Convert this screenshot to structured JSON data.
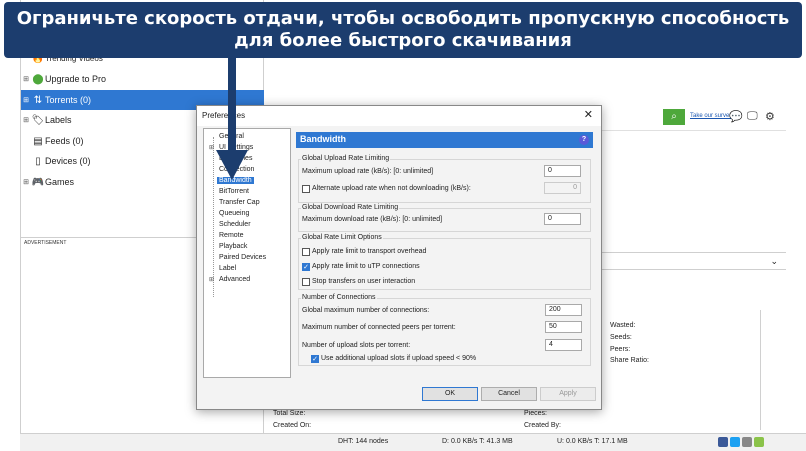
{
  "banner": {
    "text": "Ограничьте скорость отдачи, чтобы освободить пропускную способность для более быстрого скачивания"
  },
  "sidebar": {
    "items": [
      {
        "label": "Trending Videos",
        "icon": "flame-icon"
      },
      {
        "label": "Upgrade to Pro",
        "icon": "upgrade-icon"
      },
      {
        "label": "Torrents (0)",
        "icon": "torrents-icon"
      },
      {
        "label": "Labels",
        "icon": "tag-icon"
      },
      {
        "label": "Feeds (0)",
        "icon": "feed-icon"
      },
      {
        "label": "Devices (0)",
        "icon": "device-icon"
      },
      {
        "label": "Games",
        "icon": "gamepad-icon"
      }
    ],
    "ad_label": "ADVERTISEMENT"
  },
  "toolbar": {
    "survey_link": "Take our survey"
  },
  "details": {
    "labels": {
      "wasted": "Wasted:",
      "seeds": "Seeds:",
      "peers": "Peers:",
      "share_ratio": "Share Ratio:",
      "total_size": "Total Size:",
      "created_on": "Created On:",
      "pieces": "Pieces:",
      "created_by": "Created By:"
    }
  },
  "statusbar": {
    "dht": "DHT: 144 nodes",
    "down": "D: 0.0 KB/s T: 41.3 MB",
    "up": "U: 0.0 KB/s T: 17.1 MB"
  },
  "dialog": {
    "title": "Preferences",
    "tree": [
      "General",
      "UI Settings",
      "Directories",
      "Connection",
      "Bandwidth",
      "BitTorrent",
      "Transfer Cap",
      "Queueing",
      "Scheduler",
      "Remote",
      "Playback",
      "Paired Devices",
      "Label",
      "Advanced"
    ],
    "selected_tree": "Bandwidth",
    "panel_title": "Bandwidth",
    "upload_group": {
      "title": "Global Upload Rate Limiting",
      "max_label": "Maximum upload rate (kB/s): [0: unlimited]",
      "max_value": "0",
      "alt_label": "Alternate upload rate when not downloading (kB/s):",
      "alt_value": "0",
      "alt_checked": false
    },
    "download_group": {
      "title": "Global Download Rate Limiting",
      "max_label": "Maximum download rate (kB/s): [0: unlimited]",
      "max_value": "0"
    },
    "limit_group": {
      "title": "Global Rate Limit Options",
      "opt1": "Apply rate limit to transport overhead",
      "opt1_checked": false,
      "opt2": "Apply rate limit to uTP connections",
      "opt2_checked": true,
      "opt3": "Stop transfers on user interaction",
      "opt3_checked": false
    },
    "conn_group": {
      "title": "Number of Connections",
      "max_conn_label": "Global maximum number of connections:",
      "max_conn_value": "200",
      "peers_label": "Maximum number of connected peers per torrent:",
      "peers_value": "50",
      "slots_label": "Number of upload slots per torrent:",
      "slots_value": "4",
      "extra_label": "Use additional upload slots if upload speed < 90%",
      "extra_checked": true
    },
    "buttons": {
      "ok": "OK",
      "cancel": "Cancel",
      "apply": "Apply"
    }
  },
  "colors": {
    "accent": "#2f78d2",
    "banner": "#1c3d6e",
    "search": "#4ea83b"
  }
}
